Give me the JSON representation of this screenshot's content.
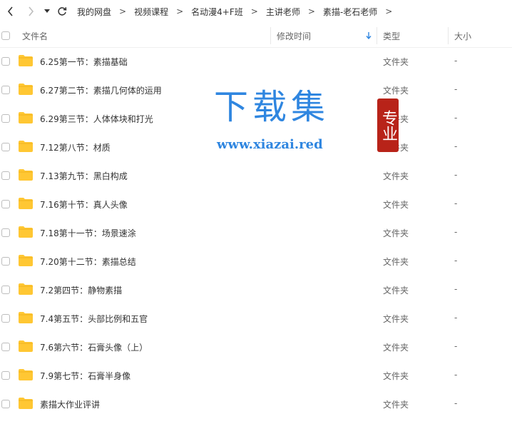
{
  "breadcrumb": [
    "我的网盘",
    "视频课程",
    "名动漫4+F班",
    "主讲老师",
    "素描-老石老师"
  ],
  "columns": {
    "name": "文件名",
    "modified": "修改时间",
    "type": "类型",
    "size": "大小"
  },
  "files": [
    {
      "name": "6.25第一节：素描基础",
      "type": "文件夹",
      "size": "-"
    },
    {
      "name": "6.27第二节：素描几何体的运用",
      "type": "文件夹",
      "size": "-"
    },
    {
      "name": "6.29第三节：人体体块和打光",
      "type": "文件夹",
      "size": "-"
    },
    {
      "name": "7.12第八节：材质",
      "type": "文件夹",
      "size": "-"
    },
    {
      "name": "7.13第九节：黑白构成",
      "type": "文件夹",
      "size": "-"
    },
    {
      "name": "7.16第十节：真人头像",
      "type": "文件夹",
      "size": "-"
    },
    {
      "name": "7.18第十一节：场景速涂",
      "type": "文件夹",
      "size": "-"
    },
    {
      "name": "7.20第十二节：素描总结",
      "type": "文件夹",
      "size": "-"
    },
    {
      "name": "7.2第四节：静物素描",
      "type": "文件夹",
      "size": "-"
    },
    {
      "name": "7.4第五节：头部比例和五官",
      "type": "文件夹",
      "size": "-"
    },
    {
      "name": "7.6第六节：石膏头像（上）",
      "type": "文件夹",
      "size": "-"
    },
    {
      "name": "7.9第七节：石膏半身像",
      "type": "文件夹",
      "size": "-"
    },
    {
      "name": "素描大作业评讲",
      "type": "文件夹",
      "size": "-"
    }
  ],
  "watermark": {
    "title": "下载集",
    "seal": "专业",
    "url": "www.xiazai.red"
  },
  "colors": {
    "folder": "#ffc733",
    "folder_tab": "#f2b31d",
    "accent": "#2f86e0",
    "seal": "#b82319"
  },
  "icons": {
    "back": "chevron-left-icon",
    "forward": "chevron-right-icon",
    "history": "caret-down-icon",
    "refresh": "refresh-icon",
    "sort": "sort-down-arrow-icon",
    "folder": "folder-icon"
  }
}
